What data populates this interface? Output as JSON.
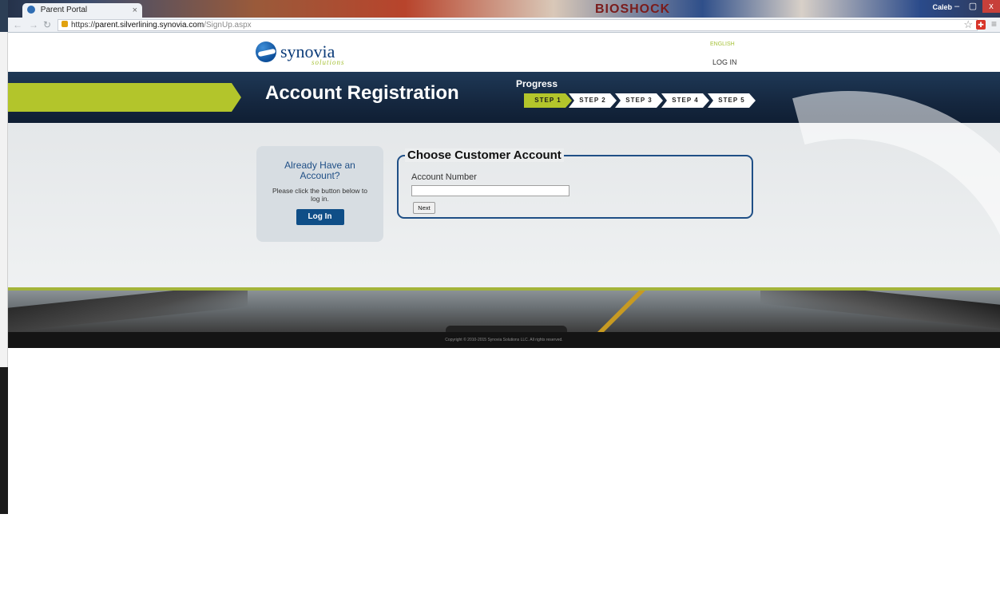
{
  "browser": {
    "tab_title": "Parent Portal",
    "tab_close": "×",
    "brand_background_text": "BIOSHOCK",
    "user_name": "Caleb",
    "min_label": "–",
    "max_label": "▢",
    "close_label": "x",
    "url_protocol": "https://",
    "url_host": "parent.silverlining.synovia.com",
    "url_path": "/SignUp.aspx",
    "back_icon": "arrow-left-icon",
    "forward_icon": "arrow-right-icon",
    "reload_icon": "reload-icon",
    "star_icon": "star-icon",
    "menu_icon": "menu-icon"
  },
  "header": {
    "logo_word": "synovia",
    "logo_sub": "solutions",
    "language": "ENGLISH",
    "login_link": "LOG IN"
  },
  "banner": {
    "title": "Account Registration",
    "progress_label": "Progress",
    "steps": [
      {
        "label": "STEP 1",
        "active": true
      },
      {
        "label": "STEP 2",
        "active": false
      },
      {
        "label": "STEP 3",
        "active": false
      },
      {
        "label": "STEP 4",
        "active": false
      },
      {
        "label": "STEP 5",
        "active": false
      }
    ]
  },
  "login_box": {
    "heading": "Already Have an Account?",
    "text": "Please click the button below to log in.",
    "button": "Log In"
  },
  "account_form": {
    "legend": "Choose Customer Account",
    "field_label": "Account Number",
    "field_value": "",
    "next_button": "Next"
  },
  "footer": {
    "copyright": "Copyright © 2010-2015 Synovia Solutions LLC. All rights reserved."
  },
  "colors": {
    "accent_green": "#b3c52b",
    "brand_blue": "#1f4f86",
    "banner_navy": "#15273f"
  }
}
